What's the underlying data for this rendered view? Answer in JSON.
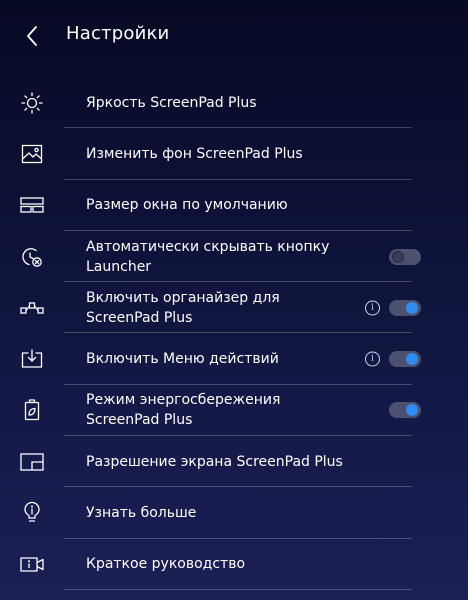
{
  "header": {
    "title": "Настройки"
  },
  "settings": {
    "items": [
      {
        "label": "Яркость ScreenPad Plus",
        "icon": "brightness-icon"
      },
      {
        "label": "Изменить фон ScreenPad Plus",
        "icon": "wallpaper-icon"
      },
      {
        "label": "Размер окна по умолчанию",
        "icon": "window-size-icon"
      },
      {
        "label": "Автоматически скрывать кнопку Launcher",
        "icon": "auto-hide-launcher-icon",
        "toggle": "off"
      },
      {
        "label": "Включить органайзер для ScreenPad Plus",
        "icon": "organizer-icon",
        "info": "i",
        "toggle": "on"
      },
      {
        "label": "Включить Меню действий",
        "icon": "action-menu-icon",
        "info": "i",
        "toggle": "on"
      },
      {
        "label": "Режим энергосбережения ScreenPad Plus",
        "icon": "power-saving-icon",
        "toggle": "on"
      },
      {
        "label": "Разрешение экрана ScreenPad Plus",
        "icon": "resolution-icon"
      },
      {
        "label": "Узнать больше",
        "icon": "lightbulb-icon"
      },
      {
        "label": "Краткое руководство",
        "icon": "guide-video-icon"
      }
    ]
  },
  "colors": {
    "accent": "#2f8cf0",
    "background_top": "#070a24",
    "background_bottom": "#1b1f55"
  }
}
